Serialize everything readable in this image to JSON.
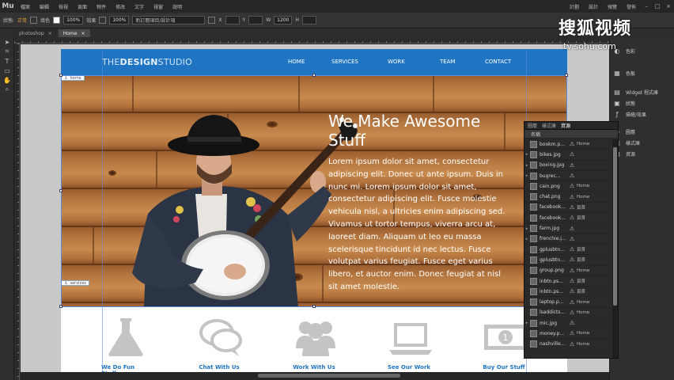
{
  "app": {
    "logo": "Mu",
    "menus": [
      "檔案",
      "編輯",
      "檢視",
      "頁面",
      "物件",
      "修改",
      "文字",
      "視窗",
      "說明"
    ],
    "right_menus": [
      "計劃",
      "設計",
      "預覽",
      "發佈"
    ]
  },
  "options": {
    "state_label": "狀態:",
    "state_value": "正常",
    "zoom": "100%",
    "opacity": "100%",
    "effect_label": "效果",
    "fill_label": "填色",
    "select_placeholder": "新訂閱項目/設計項",
    "w_label": "W",
    "w_value": "1200",
    "x_label": "X",
    "y_label": "Y",
    "h_label": "H"
  },
  "tabs": [
    {
      "label": "photoshop",
      "close": "×"
    },
    {
      "label": "Home",
      "close": "×"
    }
  ],
  "site": {
    "brand_prefix": "THE",
    "brand_bold": "DESIGN",
    "brand_suffix": "STUDIO",
    "nav": [
      "HOME",
      "SERVICES",
      "WORK",
      "TEAM",
      "CONTACT"
    ],
    "hero_tag": "home",
    "hero_tag2": "services",
    "headline": "We Make Awesome Stuff",
    "body": "Lorem ipsum dolor sit amet, consectetur adipiscing elit. Donec ut ante ipsum. Duis in nunc mi. Lorem ipsum dolor sit amet, consectetur adipiscing elit. Fusce molestie vehicula nisl, a ultricies enim adipiscing sed. Vivamus ut tortor tempus, viverra arcu at, laoreet diam. Aliquam ut leo eu massa scelerisque tincidunt id nec lectus. Fusce volutpat varius feugiat. Fusce eget varius libero, et auctor enim. Donec feugiat at nisl sit amet molestie.",
    "features": [
      {
        "label": "We Do Fun Stuff",
        "icon": "flask-icon"
      },
      {
        "label": "Chat With Us",
        "icon": "chat-icon"
      },
      {
        "label": "Work With Us",
        "icon": "group-icon"
      },
      {
        "label": "See Our Work",
        "icon": "laptop-icon"
      },
      {
        "label": "Buy Our Stuff",
        "icon": "money-icon"
      }
    ]
  },
  "right_panel": {
    "items": [
      {
        "label": "色彩",
        "icon": "swatch-icon"
      },
      {
        "label": "色板",
        "icon": "palette-icon"
      },
      {
        "label": "Widget 程式庫",
        "icon": "widget-icon"
      },
      {
        "label": "狀態",
        "icon": "states-icon"
      },
      {
        "label": "描繪/效果",
        "icon": "fx-icon"
      },
      {
        "label": "圖層",
        "icon": "layers-icon"
      },
      {
        "label": "樣式庫",
        "icon": "styles-icon"
      },
      {
        "label": "資源",
        "icon": "assets-icon"
      }
    ]
  },
  "assets_panel": {
    "tabs": [
      "圖層",
      "樣式庫",
      "資源"
    ],
    "header_name": "名稱",
    "rows": [
      {
        "name": "bookm.p...",
        "page": "Home",
        "exp": ""
      },
      {
        "name": "bikes.jpg",
        "page": "",
        "exp": "▸"
      },
      {
        "name": "boxing.jpg",
        "page": "",
        "exp": "▸"
      },
      {
        "name": "bugrec...",
        "page": "",
        "exp": "▸"
      },
      {
        "name": "cain.png",
        "page": "Home",
        "exp": ""
      },
      {
        "name": "chat.png",
        "page": "Home",
        "exp": ""
      },
      {
        "name": "facebook...",
        "page": "頁首",
        "exp": ""
      },
      {
        "name": "facebook...",
        "page": "頁首",
        "exp": ""
      },
      {
        "name": "farm.jpg",
        "page": "",
        "exp": "▸"
      },
      {
        "name": "frenchie.j...",
        "page": "",
        "exp": "▸"
      },
      {
        "name": "gplusbtn...",
        "page": "頁首",
        "exp": ""
      },
      {
        "name": "gplusbtn...",
        "page": "頁首",
        "exp": ""
      },
      {
        "name": "group.png",
        "page": "Home",
        "exp": ""
      },
      {
        "name": "inbtn.ps...",
        "page": "頁首",
        "exp": ""
      },
      {
        "name": "inbtn.ps...",
        "page": "頁首",
        "exp": ""
      },
      {
        "name": "laptop.p...",
        "page": "Home",
        "exp": ""
      },
      {
        "name": "lsaddicts...",
        "page": "Home",
        "exp": ""
      },
      {
        "name": "mic.jpg",
        "page": "",
        "exp": "▸"
      },
      {
        "name": "money.p...",
        "page": "Home",
        "exp": ""
      },
      {
        "name": "nashville...",
        "page": "Home",
        "exp": ""
      }
    ]
  },
  "watermark": {
    "title": "搜狐视频",
    "url": "tv.sohu.com"
  },
  "colors": {
    "brand_blue": "#1f75c2",
    "nav_text": "#ffffff",
    "feature_label": "#1f75c2"
  }
}
